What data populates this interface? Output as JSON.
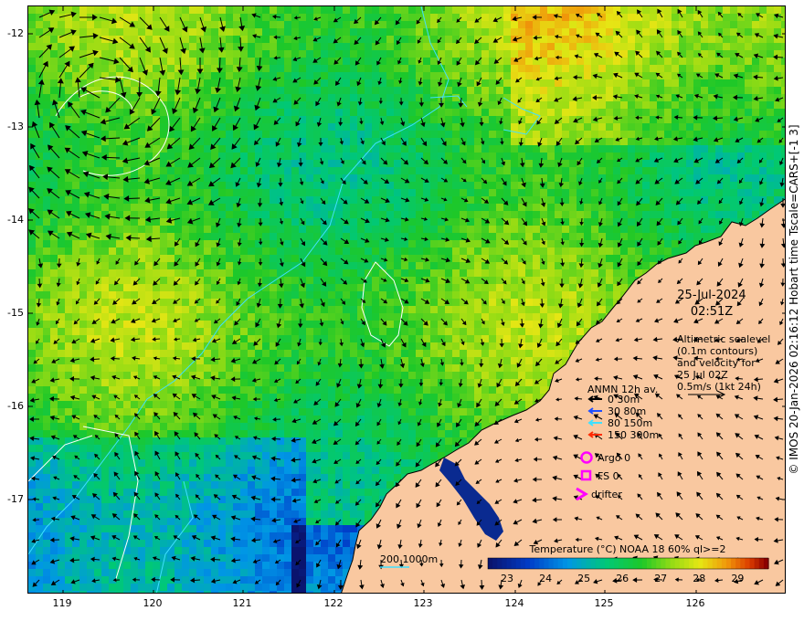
{
  "timestamp": {
    "date": "25-Jul-2024",
    "time": "02:51Z"
  },
  "altimetry_note": [
    "Altimetric sealevel",
    "(0.1m contours)",
    "and velocity for",
    "25 Jul 02Z",
    "0.5m/s (1kt 24h)"
  ],
  "anmn_legend": {
    "title": "ANMN 12h av.",
    "items": [
      {
        "label": "0 30m",
        "color": "#000000"
      },
      {
        "label": "30 80m",
        "color": "#1f4fff"
      },
      {
        "label": "80 150m",
        "color": "#40e0ff"
      },
      {
        "label": "150 300m",
        "color": "#ff2a00"
      }
    ]
  },
  "obs_legend": [
    {
      "label": "Argo 0",
      "symbol": "circle",
      "color": "#ff00ff"
    },
    {
      "label": "FS 0",
      "symbol": "square",
      "color": "#ff00ff"
    },
    {
      "label": "drifter",
      "symbol": "chevron",
      "color": "#ff00ff"
    }
  ],
  "depth_legend": {
    "label": "200  1000m"
  },
  "colorbar": {
    "title": "Temperature (°C) NOAA 18 60% ql>=2",
    "min": 22.5,
    "max": 29.8,
    "ticks": [
      "23",
      "24",
      "25",
      "26",
      "27",
      "28",
      "29"
    ]
  },
  "axes": {
    "x_ticks": [
      "119",
      "120",
      "121",
      "122",
      "123",
      "124",
      "125",
      "126"
    ],
    "y_ticks": [
      "-12",
      "-13",
      "-14",
      "-15",
      "-16",
      "-17"
    ]
  },
  "copyright": "© IMOS 20-Jan-2026 02:16:12 Hobart time Tscale=CARS+[-1 3]",
  "colors": {
    "land": "#f9c8a0",
    "contour": "#ffffff",
    "isobath": "#40e0ff"
  }
}
